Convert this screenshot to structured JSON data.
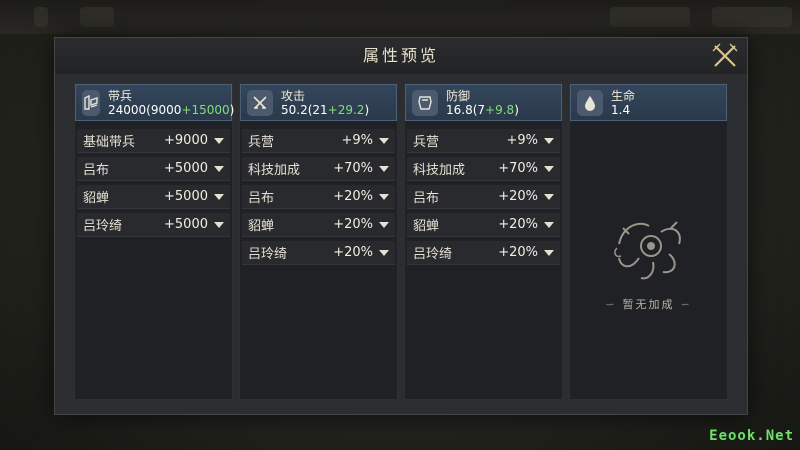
{
  "title": "属性预览",
  "columns": [
    {
      "icon": "troops-icon",
      "name": "带兵",
      "base": "24000(9000",
      "bonus": "+15000",
      "close": ")",
      "rows": [
        {
          "label": "基础带兵",
          "value": "+9000"
        },
        {
          "label": "吕布",
          "value": "+5000"
        },
        {
          "label": "貂蝉",
          "value": "+5000"
        },
        {
          "label": "吕玲绮",
          "value": "+5000"
        }
      ]
    },
    {
      "icon": "swords-icon",
      "name": "攻击",
      "base": "50.2(21",
      "bonus": "+29.2",
      "close": ")",
      "rows": [
        {
          "label": "兵营",
          "value": "+9%"
        },
        {
          "label": "科技加成",
          "value": "+70%"
        },
        {
          "label": "吕布",
          "value": "+20%"
        },
        {
          "label": "貂蝉",
          "value": "+20%"
        },
        {
          "label": "吕玲绮",
          "value": "+20%"
        }
      ]
    },
    {
      "icon": "armor-icon",
      "name": "防御",
      "base": "16.8(7",
      "bonus": "+9.8",
      "close": ")",
      "rows": [
        {
          "label": "兵营",
          "value": "+9%"
        },
        {
          "label": "科技加成",
          "value": "+70%"
        },
        {
          "label": "吕布",
          "value": "+20%"
        },
        {
          "label": "貂蝉",
          "value": "+20%"
        },
        {
          "label": "吕玲绮",
          "value": "+20%"
        }
      ]
    },
    {
      "icon": "drop-icon",
      "name": "生命",
      "value": "1.4",
      "empty_text": "暂无加成"
    }
  ],
  "watermark": "Eeook.Net"
}
